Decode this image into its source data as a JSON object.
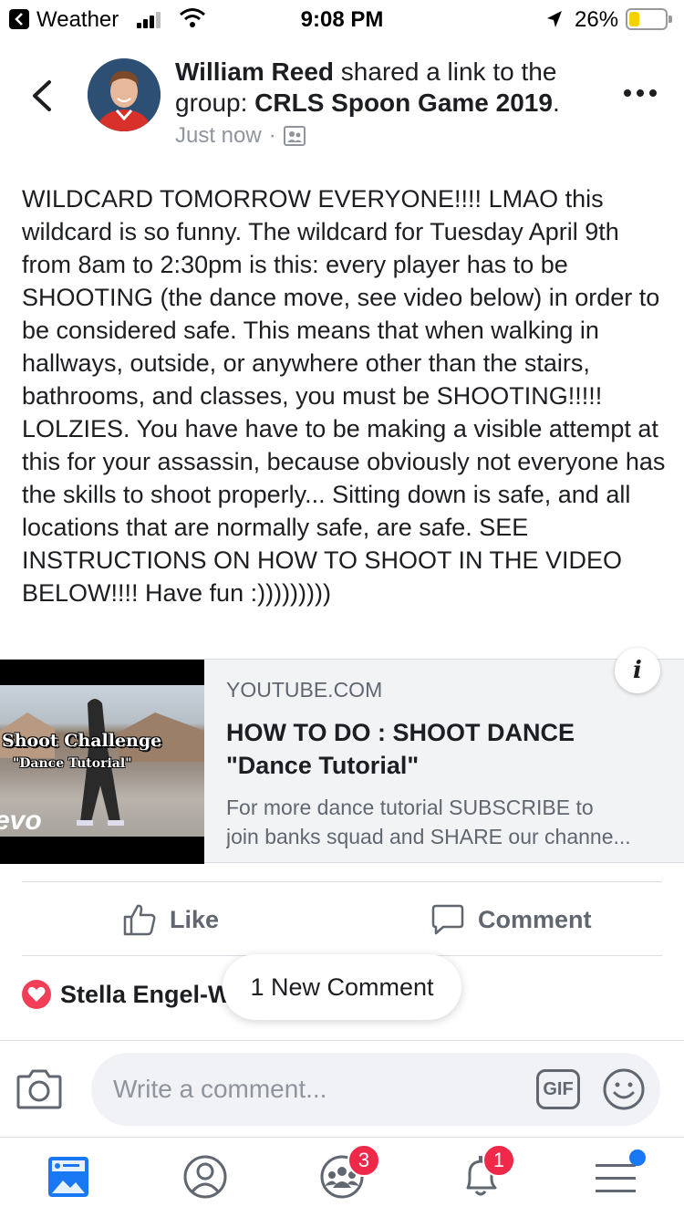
{
  "status_bar": {
    "back_app": "Weather",
    "time": "9:08 PM",
    "battery": "26%",
    "battery_level": 0.26
  },
  "post": {
    "author": "William Reed",
    "action_text": " shared a link to the group: ",
    "group": "CRLS Spoon Game 2019",
    "period": ".",
    "time": "Just now",
    "meta_separator": "·",
    "privacy_icon": "group-icon",
    "body": "WILDCARD TOMORROW EVERYONE!!!! LMAO this wildcard is so funny. The wildcard for Tuesday April 9th from 8am to 2:30pm is this: every player has to be SHOOTING (the dance move, see video below) in order to be considered safe. This means that when walking in hallways, outside, or anywhere other than the stairs, bathrooms, and classes, you must be SHOOTING!!!!! LOLZIES. You have have to be making a visible attempt at this for your assassin, because obviously not everyone has the skills to shoot properly... Sitting down is safe, and all locations that are normally safe, are safe. SEE INSTRUCTIONS ON HOW TO SHOOT IN THE VIDEO BELOW!!!! Have fun :)))))))))"
  },
  "link_card": {
    "source": "YOUTUBE.COM",
    "title": "HOW TO DO : SHOOT DANCE \"Dance Tutorial\"",
    "desc_line1": "For more dance tutorial SUBSCRIBE to",
    "desc_line2": "join banks squad and SHARE our channe...",
    "thumb_text1": "Shoot Challenge",
    "thumb_text2": "\"Dance Tutorial\"",
    "thumb_logo": "evo",
    "info_label": "i"
  },
  "actions": {
    "like": "Like",
    "comment": "Comment"
  },
  "reactions": {
    "reactor": "Stella Engel-W",
    "new_comment": "1 New Comment"
  },
  "composer": {
    "placeholder": "Write a comment...",
    "gif": "GIF"
  },
  "tabs": {
    "groups_badge": "3",
    "notifications_badge": "1"
  },
  "colors": {
    "accent": "#1877f2",
    "badge": "#f02849",
    "heart": "#f33e58",
    "battery": "#f5d100"
  }
}
